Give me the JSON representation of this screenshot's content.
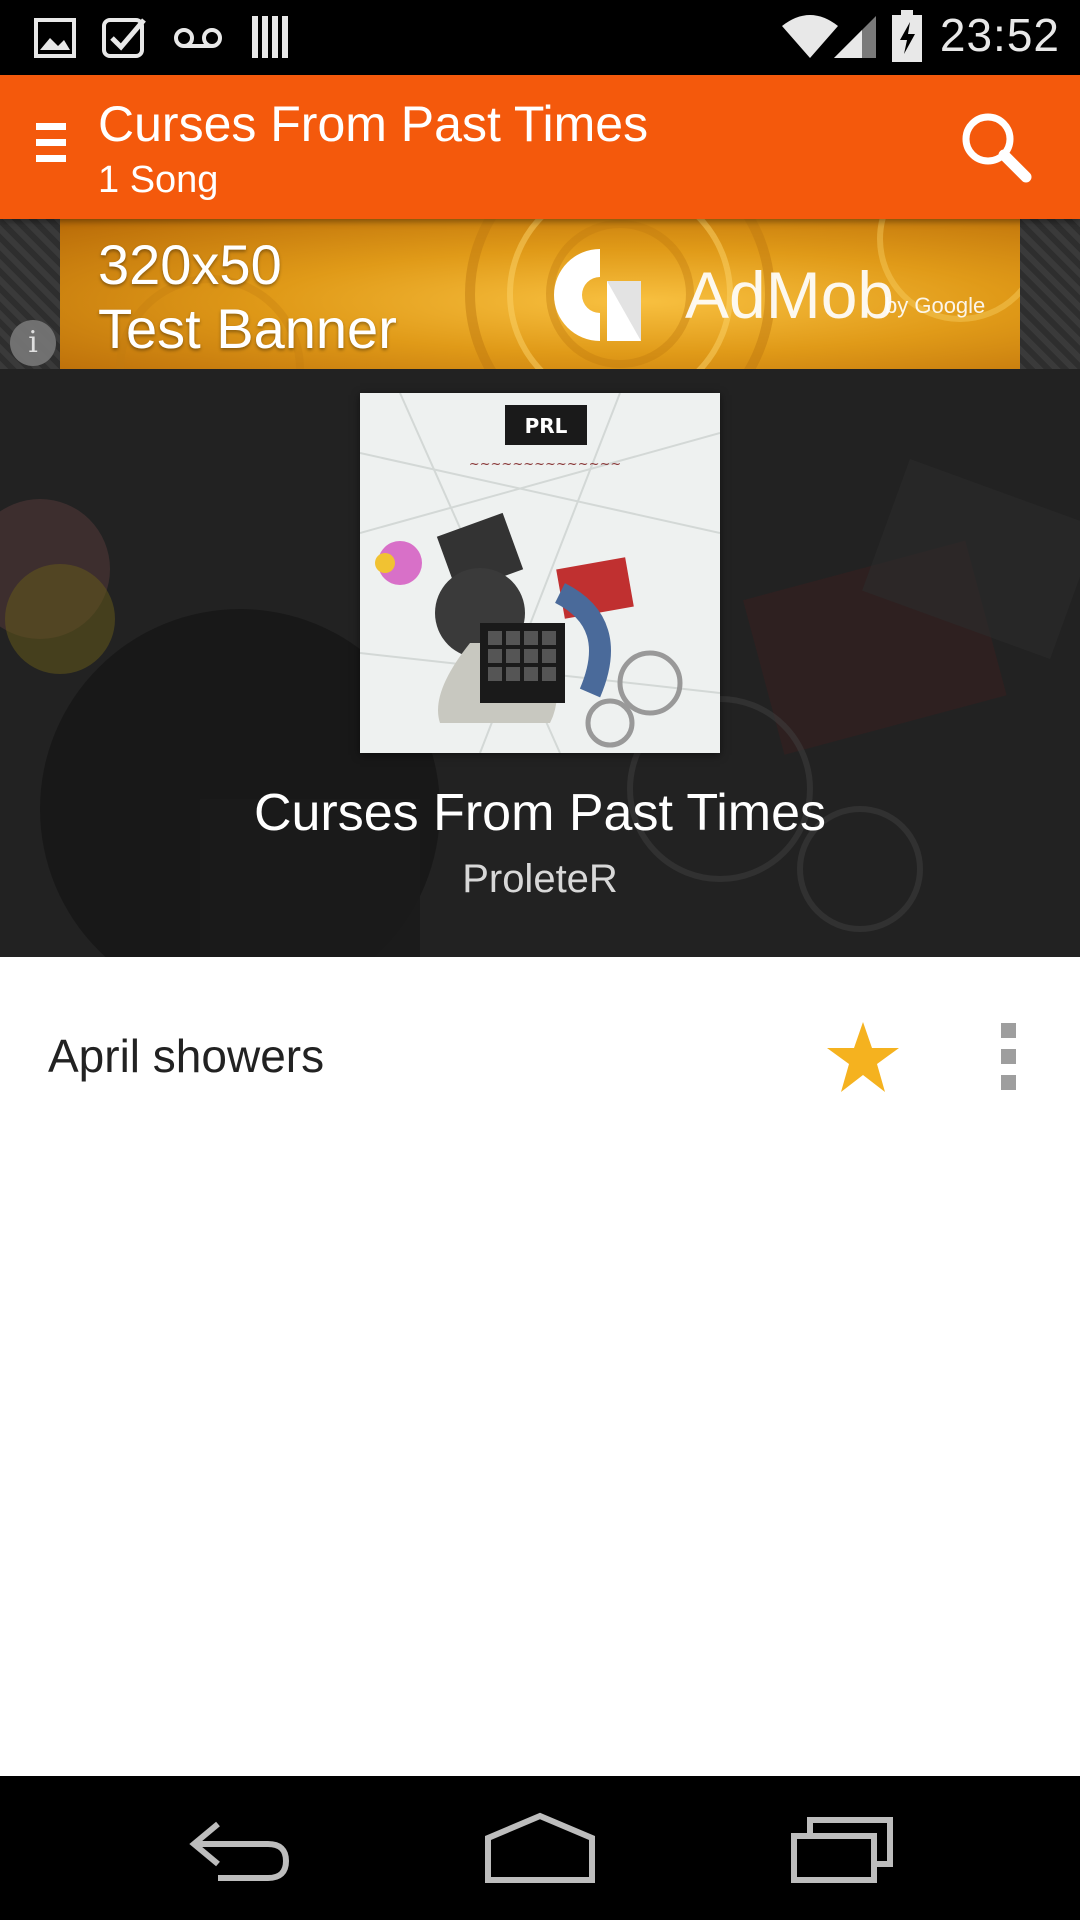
{
  "status_bar": {
    "time": "23:52",
    "left_icons": [
      "gallery-icon",
      "task-check-icon",
      "voicemail-icon",
      "library-icon"
    ],
    "right_icons": [
      "wifi-icon",
      "signal-icon",
      "battery-charging-icon"
    ]
  },
  "app_bar": {
    "title": "Curses From Past Times",
    "subtitle": "1 Song",
    "background": "#f4590c"
  },
  "ad": {
    "line1": "320x50",
    "line2": "Test Banner",
    "brand": "AdMob",
    "brand_suffix": "by Google",
    "info_symbol": "i"
  },
  "album": {
    "title": "Curses From Past Times",
    "artist": "ProleteR"
  },
  "songs": [
    {
      "title": "April showers",
      "favorite": true
    }
  ],
  "colors": {
    "accent": "#f4590c",
    "star": "#f5b21f"
  }
}
